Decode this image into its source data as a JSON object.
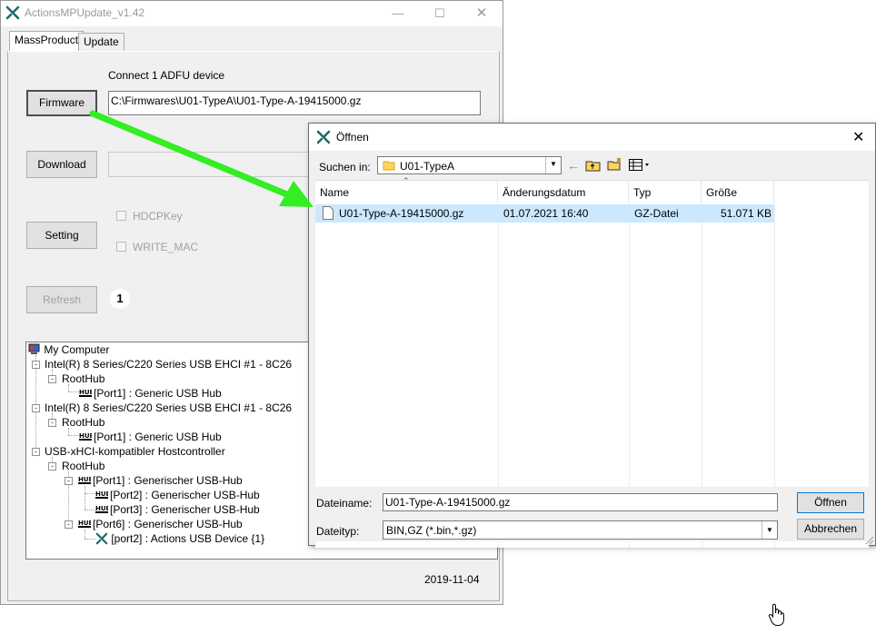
{
  "app": {
    "title": "ActionsMPUpdate_v1.42",
    "tabs": [
      "MassProduct",
      "Update"
    ],
    "device_status": "Connect 1 ADFU device",
    "firmware_label": "Firmware",
    "firmware_path": "C:\\Firmwares\\U01-TypeA\\U01-Type-A-19415000.gz",
    "download_label": "Download",
    "setting_label": "Setting",
    "refresh_label": "Refresh",
    "device_count": "1",
    "checkboxes": [
      "HDCPKey",
      "WRITE_MAC"
    ],
    "date": "2019-11-04",
    "tree": [
      "My Computer",
      "Intel(R) 8 Series/C220 Series USB EHCI #1 - 8C26",
      "RootHub",
      "[Port1] : Generic USB Hub",
      "Intel(R) 8 Series/C220 Series USB EHCI #1 - 8C26",
      "RootHub",
      "[Port1] : Generic USB Hub",
      "USB-xHCI-kompatibler Hostcontroller",
      "RootHub",
      "[Port1] : Generischer USB-Hub",
      "[Port2] : Generischer USB-Hub",
      "[Port3] : Generischer USB-Hub",
      "[Port6] : Generischer USB-Hub",
      "[port2] : Actions USB Device {1}"
    ],
    "hub_icon_text": "HUB"
  },
  "dialog": {
    "title": "Öffnen",
    "lookin_label": "Suchen in:",
    "lookin_value": "U01-TypeA",
    "columns": [
      "Name",
      "Änderungsdatum",
      "Typ",
      "Größe"
    ],
    "files": [
      {
        "name": "U01-Type-A-19415000.gz",
        "date": "01.07.2021 16:40",
        "type": "GZ-Datei",
        "size": "51.071 KB"
      }
    ],
    "filename_label": "Dateiname:",
    "filename_value": "U01-Type-A-19415000.gz",
    "filetype_label": "Dateityp:",
    "filetype_value": "BIN,GZ (*.bin,*.gz)",
    "open_label": "Öffnen",
    "cancel_label": "Abbrechen"
  },
  "colors": {
    "selection": "#cce8ff",
    "arrow": "#33ee22",
    "logo": "#1a6b6b"
  }
}
